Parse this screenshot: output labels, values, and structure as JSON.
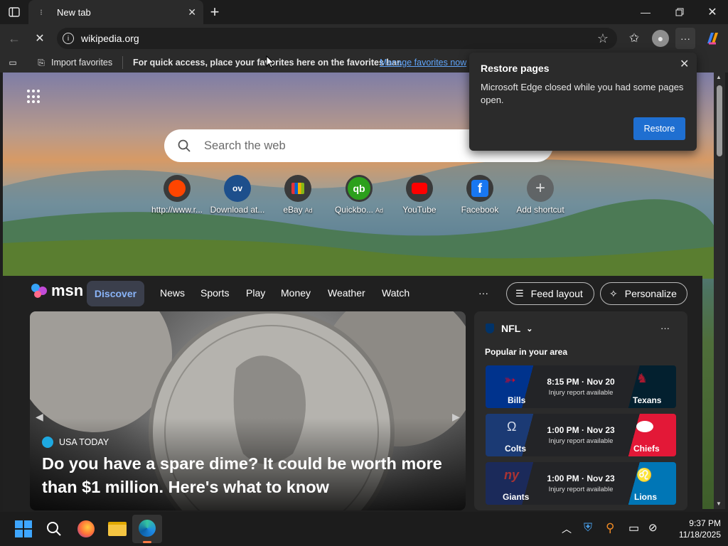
{
  "tab": {
    "title": "New tab"
  },
  "address": {
    "url": "wikipedia.org"
  },
  "favbar": {
    "import": "Import favorites",
    "message": "For quick access, place your favorites here on the favorites bar.",
    "manage": "Manage favorites now"
  },
  "search": {
    "placeholder": "Search the web"
  },
  "shortcuts": [
    {
      "label": "http://www.r...",
      "ad": ""
    },
    {
      "label": "Download at...",
      "ad": ""
    },
    {
      "label": "eBay",
      "ad": "Ad"
    },
    {
      "label": "Quickbo...",
      "ad": "Ad"
    },
    {
      "label": "YouTube",
      "ad": ""
    },
    {
      "label": "Facebook",
      "ad": ""
    },
    {
      "label": "Add shortcut",
      "ad": ""
    }
  ],
  "shortcut_icons": {
    "download": "ov"
  },
  "msn": {
    "brand": "msn",
    "nav": [
      "Discover",
      "News",
      "Sports",
      "Play",
      "Money",
      "Weather",
      "Watch"
    ],
    "more": "···",
    "feed_layout": "Feed layout",
    "personalize": "Personalize"
  },
  "hero": {
    "source": "USA TODAY",
    "headline": "Do you have a spare dime? It could be worth more than $1 million. Here's what to know"
  },
  "nfl": {
    "title": "NFL",
    "subtitle": "Popular in your area",
    "more": "···",
    "games": [
      {
        "home": "Bills",
        "away": "Texans",
        "time": "8:15 PM · Nov 20",
        "note": "Injury report available",
        "home_color": "#00338d",
        "away_color": "#03202f"
      },
      {
        "home": "Colts",
        "away": "Chiefs",
        "time": "1:00 PM · Nov 23",
        "note": "Injury report available",
        "home_color": "#1b3a74",
        "away_color": "#e31837"
      },
      {
        "home": "Giants",
        "away": "Lions",
        "time": "1:00 PM · Nov 23",
        "note": "Injury report available",
        "home_color": "#1b2a5a",
        "away_color": "#0076b6"
      }
    ]
  },
  "popup": {
    "title": "Restore pages",
    "body": "Microsoft Edge closed while you had some pages open.",
    "button": "Restore"
  },
  "tray": {
    "time": "9:37 PM",
    "date": "11/18/2025"
  },
  "colors": {
    "accent": "#1f6fd1",
    "link": "#60a5fa"
  }
}
